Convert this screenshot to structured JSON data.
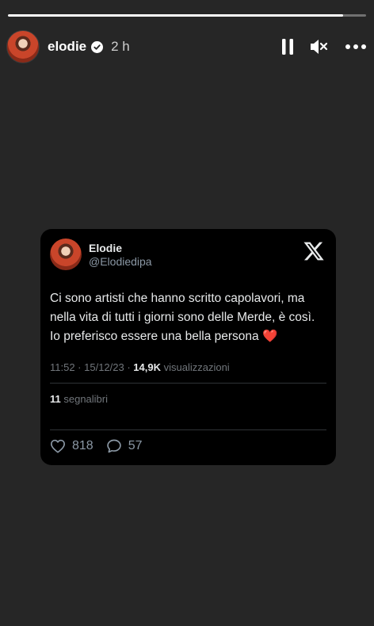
{
  "story": {
    "progress": 0.935,
    "username": "elodie",
    "time": "2 h",
    "controls": {
      "pause_icon": "pause-icon",
      "mute_icon": "muted-speaker-icon",
      "more_icon": "more-horizontal-icon"
    }
  },
  "tweet": {
    "name": "Elodie",
    "handle": "@Elodiedipa",
    "text_lines": [
      "Ci sono artisti che hanno scritto capolavori, ma",
      "nella vita di tutti i giorni sono delle Merde, è così.",
      "Io preferisco essere una bella persona"
    ],
    "emoji": "❤️",
    "timestamp": "11:52 · 15/12/23 · ",
    "views_count": "14,9K",
    "views_label": " visualizzazioni",
    "bookmarks_count": "11",
    "bookmarks_label": " segnalibri",
    "likes": "818",
    "replies": "57"
  },
  "colors": {
    "background": "#262626",
    "card": "#000000",
    "muted": "#71767b",
    "text": "#e7e9ea"
  }
}
